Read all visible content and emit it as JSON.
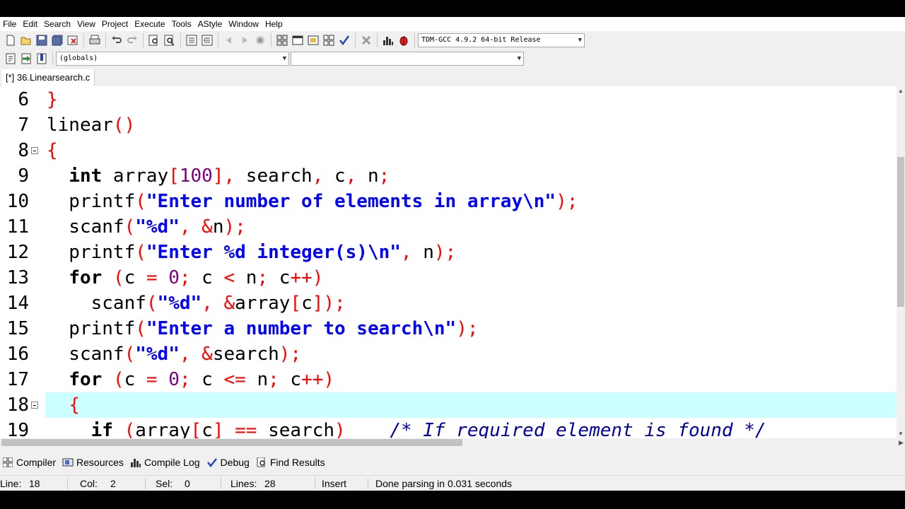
{
  "menu": [
    "File",
    "Edit",
    "Search",
    "View",
    "Project",
    "Execute",
    "Tools",
    "AStyle",
    "Window",
    "Help"
  ],
  "toolbar": {
    "compiler_select": "TDM-GCC 4.9.2 64-bit Release",
    "scope_select": "(globals)",
    "member_select": ""
  },
  "editor": {
    "tab_label": "[*] 36.Linearsearch.c",
    "current_line": 18
  },
  "code_lines": [
    {
      "n": "6",
      "tokens": [
        [
          "sym",
          "}"
        ]
      ]
    },
    {
      "n": "7",
      "tokens": [
        [
          "id",
          "linear"
        ],
        [
          "sym",
          "()"
        ]
      ]
    },
    {
      "n": "8",
      "fold": true,
      "tokens": [
        [
          "sym",
          "{"
        ]
      ]
    },
    {
      "n": "9",
      "tokens": [
        [
          "id",
          "  "
        ],
        [
          "kw",
          "int"
        ],
        [
          "id",
          " array"
        ],
        [
          "sym",
          "["
        ],
        [
          "num",
          "100"
        ],
        [
          "sym",
          "],"
        ],
        [
          "id",
          " search"
        ],
        [
          "sym",
          ","
        ],
        [
          "id",
          " c"
        ],
        [
          "sym",
          ","
        ],
        [
          "id",
          " n"
        ],
        [
          "sym",
          ";"
        ]
      ]
    },
    {
      "n": "10",
      "tokens": [
        [
          "id",
          "  printf"
        ],
        [
          "sym",
          "("
        ],
        [
          "str",
          "\"Enter number of elements in array\\n\""
        ],
        [
          "sym",
          ");"
        ]
      ]
    },
    {
      "n": "11",
      "tokens": [
        [
          "id",
          "  scanf"
        ],
        [
          "sym",
          "("
        ],
        [
          "str",
          "\"%d\""
        ],
        [
          "sym",
          ", &"
        ],
        [
          "id",
          "n"
        ],
        [
          "sym",
          ");"
        ]
      ]
    },
    {
      "n": "12",
      "tokens": [
        [
          "id",
          "  printf"
        ],
        [
          "sym",
          "("
        ],
        [
          "str",
          "\"Enter %d integer(s)\\n\""
        ],
        [
          "sym",
          ","
        ],
        [
          "id",
          " n"
        ],
        [
          "sym",
          ");"
        ]
      ]
    },
    {
      "n": "13",
      "tokens": [
        [
          "id",
          "  "
        ],
        [
          "kw",
          "for"
        ],
        [
          "id",
          " "
        ],
        [
          "sym",
          "("
        ],
        [
          "id",
          "c "
        ],
        [
          "sym",
          "="
        ],
        [
          "id",
          " "
        ],
        [
          "num",
          "0"
        ],
        [
          "sym",
          ";"
        ],
        [
          "id",
          " c "
        ],
        [
          "sym",
          "<"
        ],
        [
          "id",
          " n"
        ],
        [
          "sym",
          ";"
        ],
        [
          "id",
          " c"
        ],
        [
          "sym",
          "++)"
        ]
      ]
    },
    {
      "n": "14",
      "tokens": [
        [
          "id",
          "    scanf"
        ],
        [
          "sym",
          "("
        ],
        [
          "str",
          "\"%d\""
        ],
        [
          "sym",
          ", &"
        ],
        [
          "id",
          "array"
        ],
        [
          "sym",
          "["
        ],
        [
          "id",
          "c"
        ],
        [
          "sym",
          "]);"
        ]
      ]
    },
    {
      "n": "15",
      "tokens": [
        [
          "id",
          "  printf"
        ],
        [
          "sym",
          "("
        ],
        [
          "str",
          "\"Enter a number to search\\n\""
        ],
        [
          "sym",
          ");"
        ]
      ]
    },
    {
      "n": "16",
      "tokens": [
        [
          "id",
          "  scanf"
        ],
        [
          "sym",
          "("
        ],
        [
          "str",
          "\"%d\""
        ],
        [
          "sym",
          ", &"
        ],
        [
          "id",
          "search"
        ],
        [
          "sym",
          ");"
        ]
      ]
    },
    {
      "n": "17",
      "tokens": [
        [
          "id",
          "  "
        ],
        [
          "kw",
          "for"
        ],
        [
          "id",
          " "
        ],
        [
          "sym",
          "("
        ],
        [
          "id",
          "c "
        ],
        [
          "sym",
          "="
        ],
        [
          "id",
          " "
        ],
        [
          "num",
          "0"
        ],
        [
          "sym",
          ";"
        ],
        [
          "id",
          " c "
        ],
        [
          "sym",
          "<="
        ],
        [
          "id",
          " n"
        ],
        [
          "sym",
          ";"
        ],
        [
          "id",
          " c"
        ],
        [
          "sym",
          "++)"
        ]
      ]
    },
    {
      "n": "18",
      "fold": true,
      "current": true,
      "tokens": [
        [
          "id",
          "  "
        ],
        [
          "sym",
          "{"
        ]
      ]
    },
    {
      "n": "19",
      "tokens": [
        [
          "id",
          "    "
        ],
        [
          "kw",
          "if"
        ],
        [
          "id",
          " "
        ],
        [
          "sym",
          "("
        ],
        [
          "id",
          "array"
        ],
        [
          "sym",
          "["
        ],
        [
          "id",
          "c"
        ],
        [
          "sym",
          "]"
        ],
        [
          "id",
          " "
        ],
        [
          "sym",
          "=="
        ],
        [
          "id",
          " search"
        ],
        [
          "sym",
          ")"
        ],
        [
          "id",
          "    "
        ],
        [
          "cmt",
          "/* If required element is found */"
        ]
      ]
    }
  ],
  "bottom_tabs": [
    "Compiler",
    "Resources",
    "Compile Log",
    "Debug",
    "Find Results"
  ],
  "status": {
    "line_label": "Line:",
    "line_value": "18",
    "col_label": "Col:",
    "col_value": "2",
    "sel_label": "Sel:",
    "sel_value": "0",
    "lines_label": "Lines:",
    "lines_value": "28",
    "mode": "Insert",
    "message": "Done parsing in 0.031 seconds"
  }
}
